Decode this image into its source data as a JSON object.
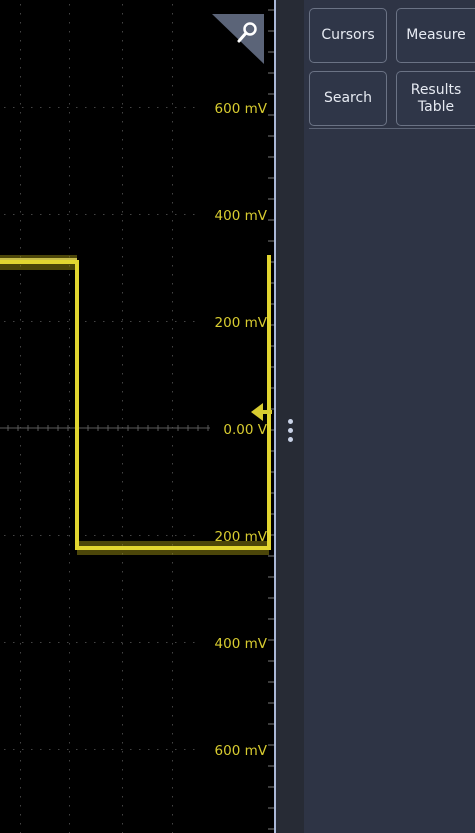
{
  "scope": {
    "voltage_labels": [
      "600 mV",
      "400 mV",
      "200 mV",
      "0.00 V",
      "200 mV",
      "400 mV",
      "600 mV"
    ],
    "trace_color": "#d8cc30",
    "grid_color": "#3a3a3a",
    "background": "#000000"
  },
  "icons": {
    "search_tab": "magnifier-icon",
    "ground_marker": "left-arrow-icon",
    "divider_handle": "vertical-ellipsis-icon"
  },
  "panel": {
    "cursors_label": "Cursors",
    "measure_label": "Measure",
    "search_label": "Search",
    "results_table_label": "Results Table",
    "background": "#2e3445"
  }
}
